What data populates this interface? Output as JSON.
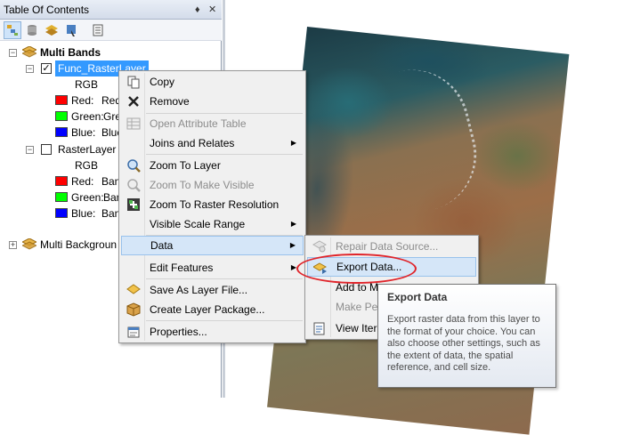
{
  "toc": {
    "title": "Table Of Contents",
    "pin": "♦",
    "close": "✕",
    "groups": [
      {
        "name": "Multi Bands",
        "layers": [
          {
            "name": "Func_RasterLayer",
            "checked": true,
            "renderer": "RGB",
            "bands": [
              {
                "label": "Red:",
                "value": "Red",
                "color": "#ff0000"
              },
              {
                "label": "Green:",
                "value": "Gre",
                "color": "#00ff00"
              },
              {
                "label": "Blue:",
                "value": "Blue",
                "color": "#0000ff"
              }
            ]
          },
          {
            "name": "RasterLayer",
            "checked": false,
            "renderer": "RGB",
            "bands": [
              {
                "label": "Red:",
                "value": "Ban",
                "color": "#ff0000"
              },
              {
                "label": "Green:",
                "value": "Ban",
                "color": "#00ff00"
              },
              {
                "label": "Blue:",
                "value": "Ban",
                "color": "#0000ff"
              }
            ]
          }
        ]
      },
      {
        "name": "Multi Backgroun"
      }
    ]
  },
  "context_menu": {
    "items": [
      {
        "label": "Copy",
        "icon": "copy-icon"
      },
      {
        "label": "Remove",
        "icon": "remove-icon"
      },
      {
        "label": "Open Attribute Table",
        "icon": "table-icon",
        "disabled": true
      },
      {
        "label": "Joins and Relates",
        "submenu": true
      },
      {
        "label": "Zoom To Layer",
        "icon": "zoom-layer-icon"
      },
      {
        "label": "Zoom To Make Visible",
        "icon": "zoom-visible-icon",
        "disabled": true
      },
      {
        "label": "Zoom To Raster Resolution",
        "icon": "zoom-resolution-icon"
      },
      {
        "label": "Visible Scale Range",
        "submenu": true
      },
      {
        "label": "Data",
        "submenu": true,
        "active": true
      },
      {
        "label": "Edit Features",
        "submenu": true
      },
      {
        "label": "Save As Layer File...",
        "icon": "layer-file-icon"
      },
      {
        "label": "Create Layer Package...",
        "icon": "layer-package-icon"
      },
      {
        "label": "Properties...",
        "icon": "properties-icon"
      }
    ]
  },
  "data_submenu": {
    "items": [
      {
        "label": "Repair Data Source...",
        "icon": "repair-icon",
        "disabled": true
      },
      {
        "label": "Export Data...",
        "icon": "export-icon",
        "active": true
      },
      {
        "label": "Add to M"
      },
      {
        "label": "Make Pe",
        "disabled": true
      },
      {
        "label": "View Iter",
        "icon": "view-icon"
      }
    ]
  },
  "tooltip": {
    "title": "Export Data",
    "body": "Export raster data from this layer to the format of your choice. You can also choose other settings, such as the extent of data, the spatial reference, and cell size."
  },
  "colors": {
    "selection": "#3399ff",
    "menu_hover": "#d5e6f8",
    "highlight": "#e0242a"
  }
}
